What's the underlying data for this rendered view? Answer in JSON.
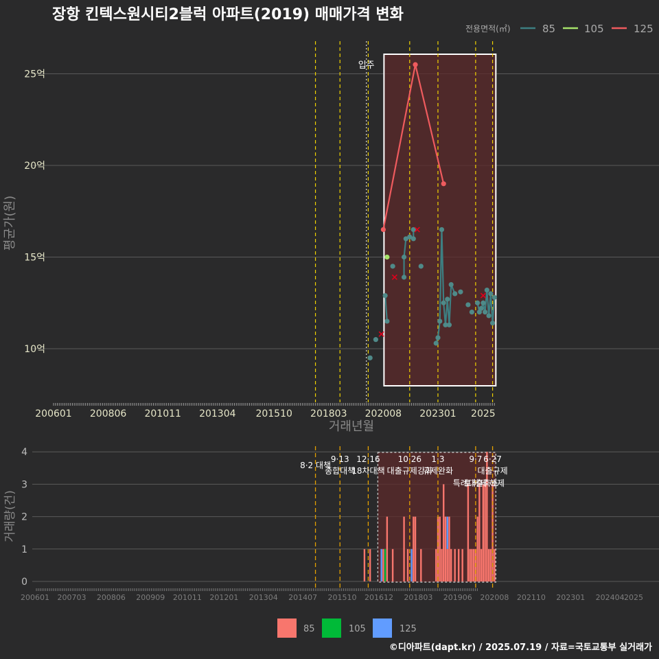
{
  "title": "장항 킨텍스원시티2블럭 아파트(2019) 매매가격 변화",
  "footer": "©디아파트(dapt.kr) / 2025.07.19 / 자료=국토교통부 실거래가",
  "colors": {
    "background": "#2a2a2b",
    "grid": "#5a5a5a",
    "s85_line": "#3d7f82",
    "s85_point": "#4f8a89",
    "s105": "#a6e36a",
    "s125": "#ef5b5e",
    "vol85": "#f8766d",
    "vol105": "#00ba38",
    "vol125": "#619cff",
    "policy": "#f2d400",
    "policy_bottom": "#e5a100",
    "cancel": "#e0001b",
    "highlight": "#5c2a2b",
    "tick_text": "#e6e6c8"
  },
  "chart_data": [
    {
      "type": "line",
      "title": "장항 킨텍스원시티2블럭 아파트(2019) 매매가격 변화",
      "xlabel": "거래년월",
      "ylabel": "평균가(원)",
      "legend_title": "전용면적(㎡)",
      "legend_position": "top-right",
      "grid": true,
      "x_ticks": [
        "200601",
        "200806",
        "201011",
        "201304",
        "201510",
        "201803",
        "202008",
        "202301",
        "2025"
      ],
      "y_ticks": [
        "10억",
        "15억",
        "20억",
        "25억"
      ],
      "y_tick_values": [
        10,
        15,
        20,
        25
      ],
      "ylim": [
        7.5,
        27
      ],
      "y_unit": "억",
      "move_in_label": "입주",
      "move_in_date": "2019-11",
      "policy_dates": [
        "2017-08",
        "2018-09",
        "2019-12",
        "2021-10",
        "2023-01",
        "2024-09",
        "2025-06"
      ],
      "highlight_range": [
        "2020-08",
        "2025-07"
      ],
      "series": [
        {
          "name": "85",
          "segments": [
            [
              [
                "2020-01",
                9.5
              ]
            ],
            [
              [
                "2020-04",
                10.5
              ]
            ],
            [
              [
                "2020-09",
                12.9
              ],
              [
                "2020-10",
                11.5
              ]
            ],
            [
              [
                "2021-01",
                14.5
              ]
            ],
            [
              [
                "2021-07",
                13.9
              ],
              [
                "2021-07",
                15.0
              ],
              [
                "2021-08",
                16.0
              ],
              [
                "2021-10",
                16.1
              ],
              [
                "2021-12",
                16.0
              ],
              [
                "2021-12",
                16.5
              ]
            ],
            [
              [
                "2022-04",
                14.5
              ]
            ],
            [
              [
                "2022-12",
                10.3
              ],
              [
                "2023-01",
                10.6
              ],
              [
                "2023-02",
                11.5
              ],
              [
                "2023-03",
                16.5
              ],
              [
                "2023-04",
                12.5
              ],
              [
                "2023-05",
                11.3
              ],
              [
                "2023-06",
                12.7
              ],
              [
                "2023-07",
                11.3
              ],
              [
                "2023-08",
                13.5
              ],
              [
                "2023-10",
                13.0
              ]
            ],
            [
              [
                "2024-01",
                13.1
              ]
            ],
            [
              [
                "2024-05",
                12.4
              ]
            ],
            [
              [
                "2024-07",
                12.0
              ]
            ],
            [
              [
                "2024-10",
                12.5
              ],
              [
                "2024-11",
                12.0
              ],
              [
                "2024-12",
                12.2
              ],
              [
                "2025-01",
                12.5
              ],
              [
                "2025-02",
                12.0
              ],
              [
                "2025-03",
                13.2
              ],
              [
                "2025-04",
                11.8
              ],
              [
                "2025-05",
                13.0
              ],
              [
                "2025-06",
                11.4
              ],
              [
                "2025-07",
                12.8
              ]
            ]
          ]
        },
        {
          "name": "105",
          "segments": [
            [
              [
                "2020-10",
                15.0
              ]
            ]
          ]
        },
        {
          "name": "125",
          "segments": [
            [
              [
                "2020-08",
                16.5
              ],
              [
                "2022-01",
                25.5
              ],
              [
                "2023-04",
                19.0
              ]
            ]
          ]
        }
      ],
      "cancelled_deals": [
        [
          "2020-07",
          10.8
        ],
        [
          "2021-02",
          13.9
        ],
        [
          "2022-02",
          16.5
        ],
        [
          "2025-01",
          12.9
        ]
      ]
    },
    {
      "type": "bar",
      "ylabel": "거래량(건)",
      "y_ticks": [
        "0",
        "1",
        "2",
        "3",
        "4"
      ],
      "ylim": [
        0,
        4
      ],
      "x_ticks": [
        "200601",
        "200703",
        "200806",
        "200909",
        "201011",
        "201201",
        "201304",
        "201407",
        "201510",
        "201612",
        "201803",
        "201906",
        "202008",
        "202110",
        "202301",
        "202404",
        "2025"
      ],
      "legend": [
        "85",
        "105",
        "125"
      ],
      "legend_position": "bottom",
      "policy_labels": [
        {
          "date": "2017-08",
          "text1": "",
          "text2": "8·2 대책"
        },
        {
          "date": "2018-09",
          "text1": "9·13",
          "text2": "종합대책"
        },
        {
          "date": "2019-12",
          "text1": "12·16",
          "text2": "18차대책"
        },
        {
          "date": "2021-10",
          "text1": "10·26",
          "text2": "대출규제강화"
        },
        {
          "date": "2023-01",
          "text1": "1·3",
          "text2": "규제완화"
        },
        {
          "date": "2024-09",
          "text1": "9·7",
          "text2": "특례대출축소"
        },
        {
          "date": "2025-06",
          "text1": "6·27",
          "text2": "대출규제"
        }
      ],
      "policy_extra_label": "토허제 해제",
      "bars": [
        {
          "date": "2019-10",
          "s85": 1,
          "s105": 0,
          "s125": 0
        },
        {
          "date": "2020-01",
          "s85": 1,
          "s105": 0,
          "s125": 0
        },
        {
          "date": "2020-07",
          "s85": 0,
          "s105": 0,
          "s125": 1
        },
        {
          "date": "2020-08",
          "s85": 1,
          "s105": 0,
          "s125": 0
        },
        {
          "date": "2020-09",
          "s85": 0,
          "s105": 1,
          "s125": 0
        },
        {
          "date": "2020-10",
          "s85": 2,
          "s105": 0,
          "s125": 0
        },
        {
          "date": "2021-01",
          "s85": 1,
          "s105": 0,
          "s125": 0
        },
        {
          "date": "2021-07",
          "s85": 2,
          "s105": 0,
          "s125": 0
        },
        {
          "date": "2021-09",
          "s85": 1,
          "s105": 0,
          "s125": 0
        },
        {
          "date": "2021-11",
          "s85": 0,
          "s105": 0,
          "s125": 1
        },
        {
          "date": "2021-12",
          "s85": 2,
          "s105": 0,
          "s125": 0
        },
        {
          "date": "2022-01",
          "s85": 2,
          "s105": 0,
          "s125": 0
        },
        {
          "date": "2022-04",
          "s85": 1,
          "s105": 0,
          "s125": 0
        },
        {
          "date": "2022-12",
          "s85": 1,
          "s105": 0,
          "s125": 0
        },
        {
          "date": "2023-01",
          "s85": 2,
          "s105": 0,
          "s125": 0
        },
        {
          "date": "2023-02",
          "s85": 2,
          "s105": 0,
          "s125": 0
        },
        {
          "date": "2023-03",
          "s85": 1,
          "s105": 0,
          "s125": 0
        },
        {
          "date": "2023-04",
          "s85": 3,
          "s105": 0,
          "s125": 0
        },
        {
          "date": "2023-05",
          "s85": 2,
          "s105": 0,
          "s125": 0
        },
        {
          "date": "2023-06",
          "s85": 1,
          "s105": 0,
          "s125": 1
        },
        {
          "date": "2023-07",
          "s85": 2,
          "s105": 0,
          "s125": 0
        },
        {
          "date": "2023-08",
          "s85": 1,
          "s105": 0,
          "s125": 0
        },
        {
          "date": "2023-10",
          "s85": 1,
          "s105": 0,
          "s125": 0
        },
        {
          "date": "2023-12",
          "s85": 1,
          "s105": 0,
          "s125": 0
        },
        {
          "date": "2024-02",
          "s85": 1,
          "s105": 0,
          "s125": 0
        },
        {
          "date": "2024-05",
          "s85": 3,
          "s105": 0,
          "s125": 0
        },
        {
          "date": "2024-06",
          "s85": 1,
          "s105": 0,
          "s125": 0
        },
        {
          "date": "2024-07",
          "s85": 1,
          "s105": 0,
          "s125": 0
        },
        {
          "date": "2024-08",
          "s85": 1,
          "s105": 0,
          "s125": 0
        },
        {
          "date": "2024-09",
          "s85": 1,
          "s105": 0,
          "s125": 0
        },
        {
          "date": "2024-10",
          "s85": 2,
          "s105": 0,
          "s125": 0
        },
        {
          "date": "2024-11",
          "s85": 3,
          "s105": 0,
          "s125": 0
        },
        {
          "date": "2024-12",
          "s85": 1,
          "s105": 0,
          "s125": 0
        },
        {
          "date": "2025-01",
          "s85": 3,
          "s105": 0,
          "s125": 0
        },
        {
          "date": "2025-02",
          "s85": 3,
          "s105": 0,
          "s125": 0
        },
        {
          "date": "2025-03",
          "s85": 4,
          "s105": 0,
          "s125": 0
        },
        {
          "date": "2025-04",
          "s85": 1,
          "s105": 0,
          "s125": 0
        },
        {
          "date": "2025-05",
          "s85": 1,
          "s105": 0,
          "s125": 0
        },
        {
          "date": "2025-06",
          "s85": 3,
          "s105": 0,
          "s125": 0
        },
        {
          "date": "2025-07",
          "s85": 1,
          "s105": 0,
          "s125": 0
        }
      ]
    }
  ]
}
